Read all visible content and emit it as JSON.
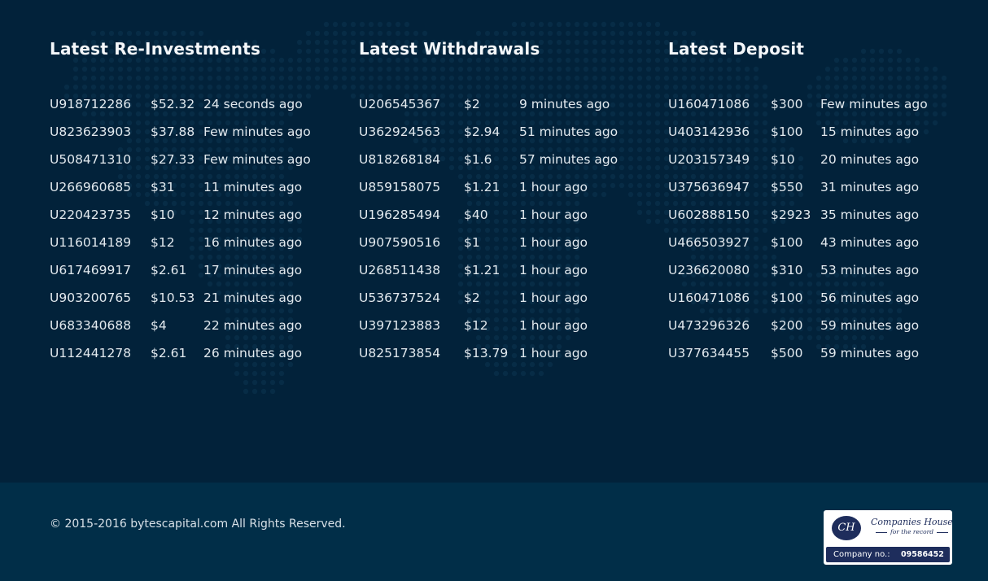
{
  "sections": [
    {
      "title": "Latest Re-Investments",
      "rows": [
        [
          "U918712286",
          "$52.32",
          "24 seconds ago"
        ],
        [
          "U823623903",
          "$37.88",
          "Few minutes ago"
        ],
        [
          "U508471310",
          "$27.33",
          "Few minutes ago"
        ],
        [
          "U266960685",
          "$31",
          "11 minutes ago"
        ],
        [
          "U220423735",
          "$10",
          "12 minutes ago"
        ],
        [
          "U116014189",
          "$12",
          "16 minutes ago"
        ],
        [
          "U617469917",
          "$2.61",
          "17 minutes ago"
        ],
        [
          "U903200765",
          "$10.53",
          "21 minutes ago"
        ],
        [
          "U683340688",
          "$4",
          "22 minutes ago"
        ],
        [
          "U112441278",
          "$2.61",
          "26 minutes ago"
        ]
      ]
    },
    {
      "title": "Latest Withdrawals",
      "rows": [
        [
          "U206545367",
          "$2",
          "9 minutes ago"
        ],
        [
          "U362924563",
          "$2.94",
          "51 minutes ago"
        ],
        [
          "U818268184",
          "$1.6",
          "57 minutes ago"
        ],
        [
          "U859158075",
          "$1.21",
          "1 hour ago"
        ],
        [
          "U196285494",
          "$40",
          "1 hour ago"
        ],
        [
          "U907590516",
          "$1",
          "1 hour ago"
        ],
        [
          "U268511438",
          "$1.21",
          "1 hour ago"
        ],
        [
          "U536737524",
          "$2",
          "1 hour ago"
        ],
        [
          "U397123883",
          "$12",
          "1 hour ago"
        ],
        [
          "U825173854",
          "$13.79",
          "1 hour ago"
        ]
      ]
    },
    {
      "title": "Latest Deposit",
      "rows": [
        [
          "U160471086",
          "$300",
          "Few minutes ago"
        ],
        [
          "U403142936",
          "$100",
          "15 minutes ago"
        ],
        [
          "U203157349",
          "$10",
          "20 minutes ago"
        ],
        [
          "U375636947",
          "$550",
          "31 minutes ago"
        ],
        [
          "U602888150",
          "$2923",
          "35 minutes ago"
        ],
        [
          "U466503927",
          "$100",
          "43 minutes ago"
        ],
        [
          "U236620080",
          "$310",
          "53 minutes ago"
        ],
        [
          "U160471086",
          "$100",
          "56 minutes ago"
        ],
        [
          "U473296326",
          "$200",
          "59 minutes ago"
        ],
        [
          "U377634455",
          "$500",
          "59 minutes ago"
        ]
      ]
    }
  ],
  "footer": {
    "copyright": "© 2015-2016 bytescapital.com All Rights Reserved.",
    "badge": {
      "logo_text": "CH",
      "name": "Companies House",
      "tagline": "for the record",
      "company_label": "Company no.:",
      "company_number": "09586452"
    }
  },
  "colors": {
    "background": "#02223a",
    "footer": "#012e48",
    "map_dots": "#0c3450",
    "badge_navy": "#1e2d5c"
  },
  "icons": {
    "background": "world-map-dots",
    "badge_logo": "companies-house-logo-icon"
  }
}
